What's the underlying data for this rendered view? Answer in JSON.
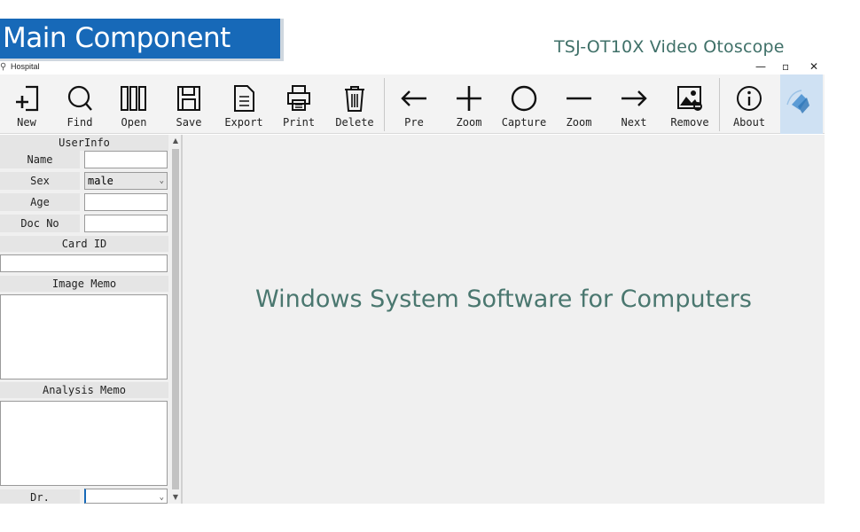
{
  "banner": {
    "title": "Main Component"
  },
  "product": {
    "name": "TSJ-OT10X  Video Otoscope"
  },
  "window": {
    "title": "Hospital",
    "minimize": "—",
    "maximize": "▫",
    "close": "✕"
  },
  "toolbar": {
    "new": "New",
    "find": "Find",
    "open": "Open",
    "save": "Save",
    "export": "Export",
    "print": "Print",
    "delete": "Delete",
    "pre": "Pre",
    "zoom_in": "Zoom",
    "capture": "Capture",
    "zoom_out": "Zoom",
    "next": "Next",
    "remove": "Remove",
    "about": "About"
  },
  "panel": {
    "userinfo": "UserInfo",
    "name_label": "Name",
    "name_value": "",
    "sex_label": "Sex",
    "sex_value": "male",
    "age_label": "Age",
    "age_value": "",
    "docno_label": "Doc No",
    "docno_value": "",
    "cardid_label": "Card ID",
    "cardid_value": "",
    "image_memo_label": "Image Memo",
    "analysis_memo_label": "Analysis Memo",
    "dr_label": "Dr.",
    "dr_value": ""
  },
  "viewer": {
    "caption": "Windows System Software for Computers"
  },
  "colors": {
    "banner": "#1769b8",
    "caption": "#4a776f",
    "logo_bg": "#cfe1f3"
  }
}
